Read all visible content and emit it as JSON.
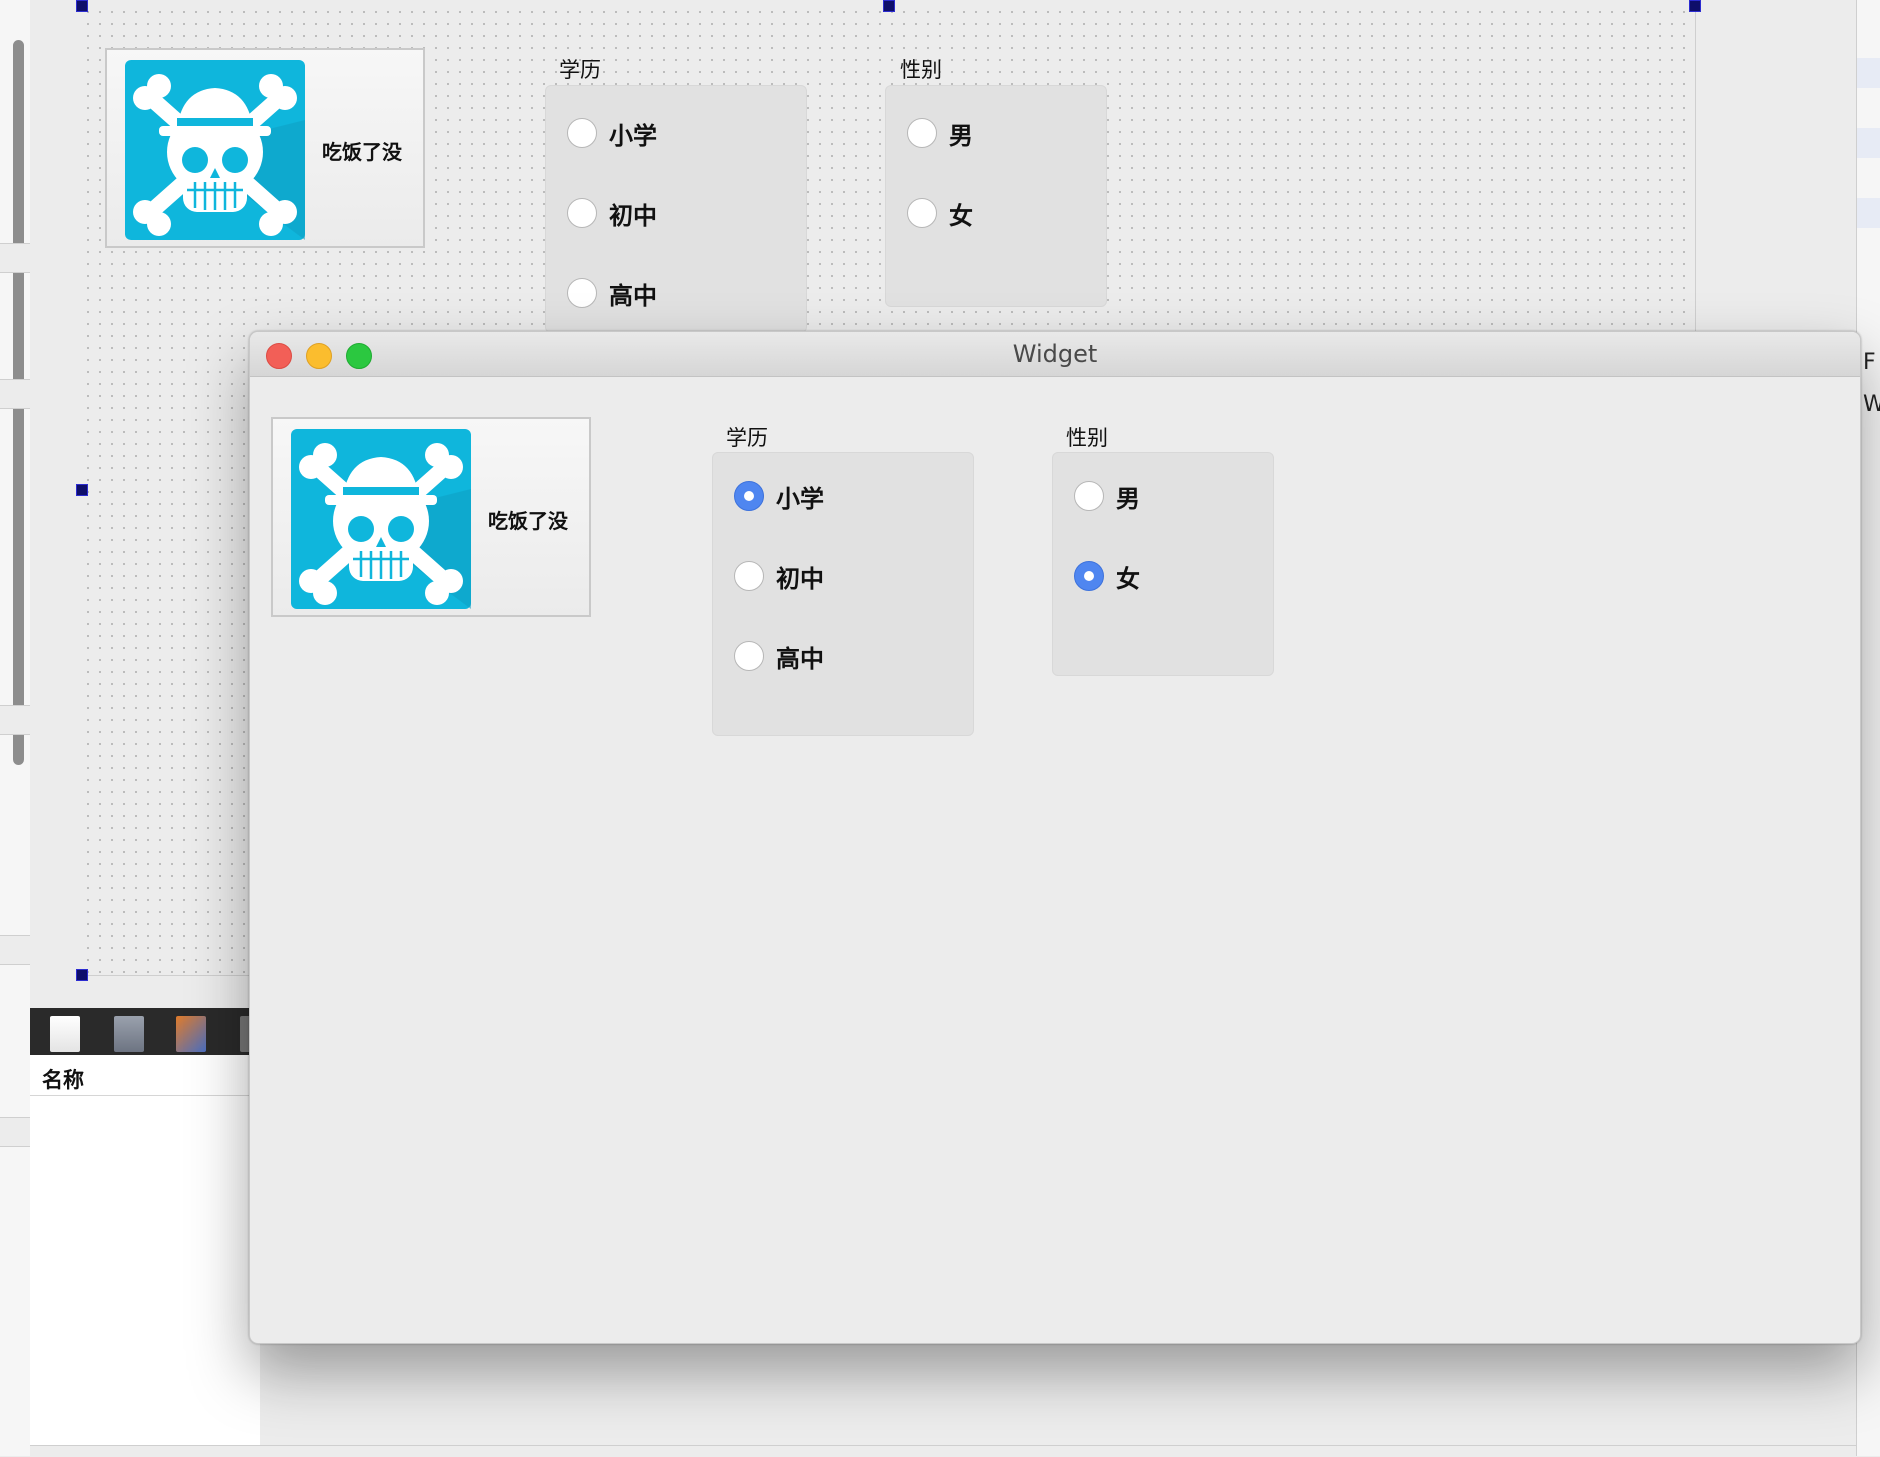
{
  "designer": {
    "card": {
      "caption": "吃饭了没",
      "logo": "straw-hat-jolly-roger-icon"
    },
    "education": {
      "title": "学历",
      "options": [
        "小学",
        "初中",
        "高中"
      ]
    },
    "gender": {
      "title": "性别",
      "options": [
        "男",
        "女"
      ]
    },
    "bottom_panel": {
      "column_header": "名称"
    },
    "right_panel": {
      "letters": [
        "F",
        "W"
      ]
    }
  },
  "window": {
    "title": "Widget",
    "card": {
      "caption": "吃饭了没",
      "logo": "straw-hat-jolly-roger-icon"
    },
    "education": {
      "title": "学历",
      "options": [
        {
          "label": "小学",
          "checked": true
        },
        {
          "label": "初中",
          "checked": false
        },
        {
          "label": "高中",
          "checked": false
        }
      ]
    },
    "gender": {
      "title": "性别",
      "options": [
        {
          "label": "男",
          "checked": false
        },
        {
          "label": "女",
          "checked": true
        }
      ]
    }
  },
  "colors": {
    "logo_background": "#0fb6dc",
    "radio_checked": "#4f86f0",
    "close": "#f25f57",
    "minimize": "#fbbd2e",
    "maximize": "#2bc840"
  }
}
